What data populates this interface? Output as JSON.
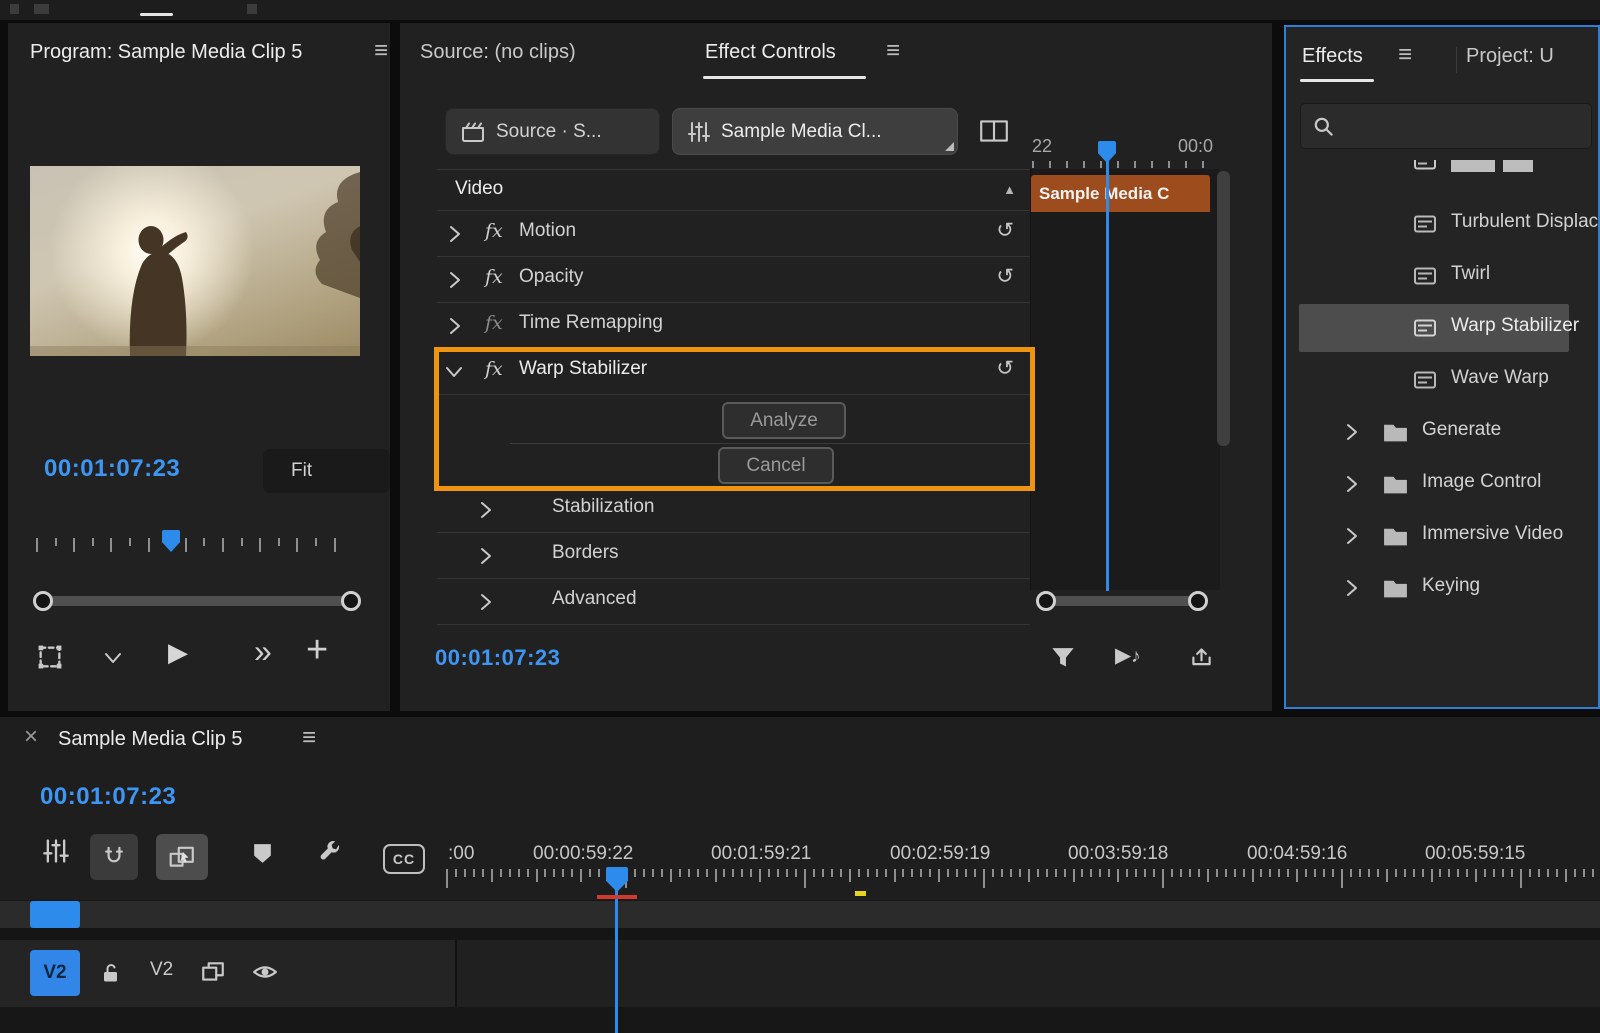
{
  "icons": {
    "menu": "≡",
    "close": "×",
    "fx": "fx",
    "reset": "↺",
    "collapse": "▲",
    "play": "▶",
    "skip": "»",
    "add": "+",
    "note": "♪"
  },
  "program": {
    "title": "Program: Sample Media Clip 5",
    "timecode": "00:01:07:23",
    "zoom_label": "Fit"
  },
  "effect_controls": {
    "source_tab": "Source: (no clips)",
    "tab": "Effect Controls",
    "source_button": "Source · S...",
    "clip_button": "Sample Media Cl...",
    "video_section": "Video",
    "rows": [
      {
        "label": "Motion"
      },
      {
        "label": "Opacity"
      },
      {
        "label": "Time Remapping"
      },
      {
        "label": "Warp Stabilizer"
      }
    ],
    "analyze_button": "Analyze",
    "cancel_button": "Cancel",
    "groups": [
      {
        "label": "Stabilization"
      },
      {
        "label": "Borders"
      },
      {
        "label": "Advanced"
      }
    ],
    "timecode": "00:01:07:23",
    "mini_timeline": {
      "tick_left": "22",
      "tick_right": "00:0",
      "clip_label": "Sample Media C"
    }
  },
  "effects_panel": {
    "tab": "Effects",
    "project_tab": "Project: U",
    "items": [
      {
        "label": "Turbulent Displace"
      },
      {
        "label": "Twirl"
      },
      {
        "label": "Warp Stabilizer"
      },
      {
        "label": "Wave Warp"
      },
      {
        "label": "Generate"
      },
      {
        "label": "Image Control"
      },
      {
        "label": "Immersive Video"
      },
      {
        "label": "Keying"
      }
    ]
  },
  "timeline": {
    "tab": "Sample Media Clip 5",
    "timecode": "00:01:07:23",
    "cc": "CC",
    "ruler_labels": [
      ":00",
      "00:00:59:22",
      "00:01:59:21",
      "00:02:59:19",
      "00:03:59:18",
      "00:04:59:16",
      "00:05:59:15"
    ],
    "track_badge": "V2",
    "track_name": "V2"
  }
}
